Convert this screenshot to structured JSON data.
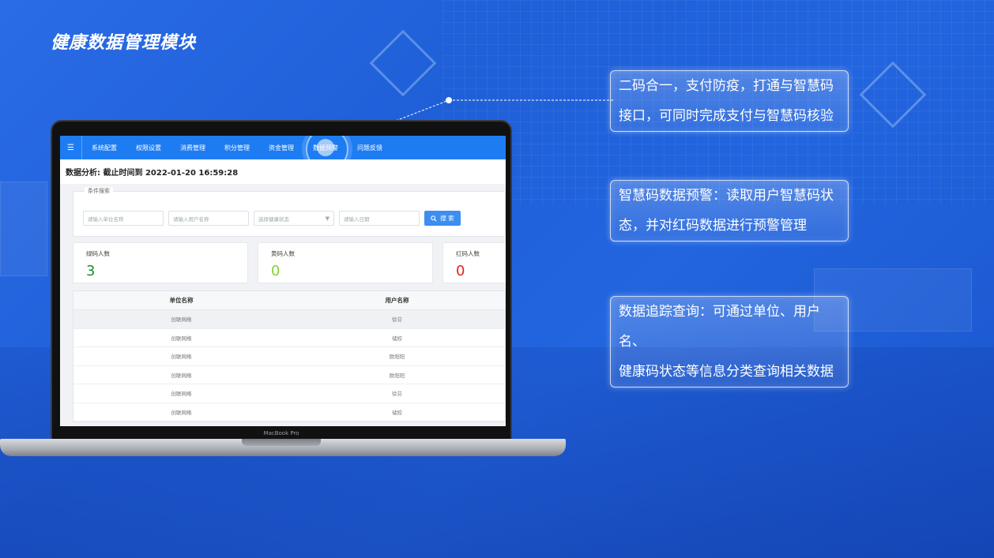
{
  "page_title": "健康数据管理模块",
  "laptop": {
    "brand": "MacBook Pro",
    "app": {
      "menu_icon": "☰",
      "nav": [
        "系统配置",
        "权限设置",
        "消费管理",
        "积分管理",
        "资金管理",
        "数据预警",
        "问题反馈"
      ],
      "active_nav": "数据预警",
      "analysis_label": "数据分析:  截止时间到 2022-01-20 16:59:28",
      "search": {
        "legend": "条件搜索",
        "unit_placeholder": "请输入单位名称",
        "user_placeholder": "请输入用户名称",
        "status_placeholder": "选择健康状态",
        "date_placeholder": "请输入日期",
        "search_button": "搜 索"
      },
      "stats": [
        {
          "label": "绿码人数",
          "value": "3",
          "color": "#1a8f2a"
        },
        {
          "label": "黄码人数",
          "value": "0",
          "color": "#7fd13b"
        },
        {
          "label": "红码人数",
          "value": "0",
          "color": "#e0261f"
        }
      ],
      "table": {
        "headers": [
          "单位名称",
          "用户名称"
        ],
        "rows": [
          [
            "创联网络",
            "徐芬"
          ],
          [
            "创联网络",
            "储姣"
          ],
          [
            "创联网络",
            "欧阳阳"
          ],
          [
            "创联网络",
            "欧阳阳"
          ],
          [
            "创联网络",
            "徐芬"
          ],
          [
            "创联网络",
            "储姣"
          ]
        ]
      }
    }
  },
  "callouts": [
    {
      "line1": "二码合一，支付防疫，打通与智慧码",
      "line2": "接口，可同时完成支付与智慧码核验"
    },
    {
      "line1": "智慧码数据预警：读取用户智慧码状",
      "line2": "态，并对红码数据进行预警管理"
    },
    {
      "line1": "数据追踪查询：可通过单位、用户名、",
      "line2": "健康码状态等信息分类查询相关数据"
    }
  ]
}
